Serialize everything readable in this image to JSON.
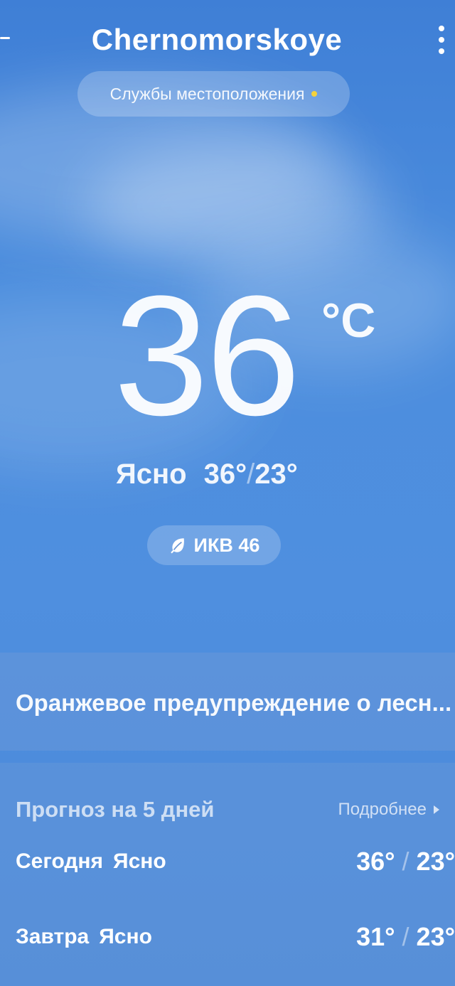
{
  "header": {
    "city": "Chernomorskoye"
  },
  "location_services": {
    "label": "Службы местоположения",
    "dot_color": "#f5d23c"
  },
  "current": {
    "temperature": "36",
    "unit": "°C",
    "condition": "Ясно",
    "high": "36°",
    "low": "23°",
    "aqi_label": "ИКВ 46"
  },
  "warning": {
    "text": "Оранжевое предупреждение о лесн..."
  },
  "forecast": {
    "title": "Прогноз на 5 дней",
    "more_label": "Подробнее",
    "days": [
      {
        "day": "Сегодня",
        "condition": "Ясно",
        "high": "36°",
        "low": "23°"
      },
      {
        "day": "Завтра",
        "condition": "Ясно",
        "high": "31°",
        "low": "23°"
      }
    ]
  },
  "icons": {
    "back": "back-arrow-icon",
    "more": "more-vertical-icon",
    "aqi": "leaf-icon",
    "forecast_more": "triangle-right-icon"
  }
}
